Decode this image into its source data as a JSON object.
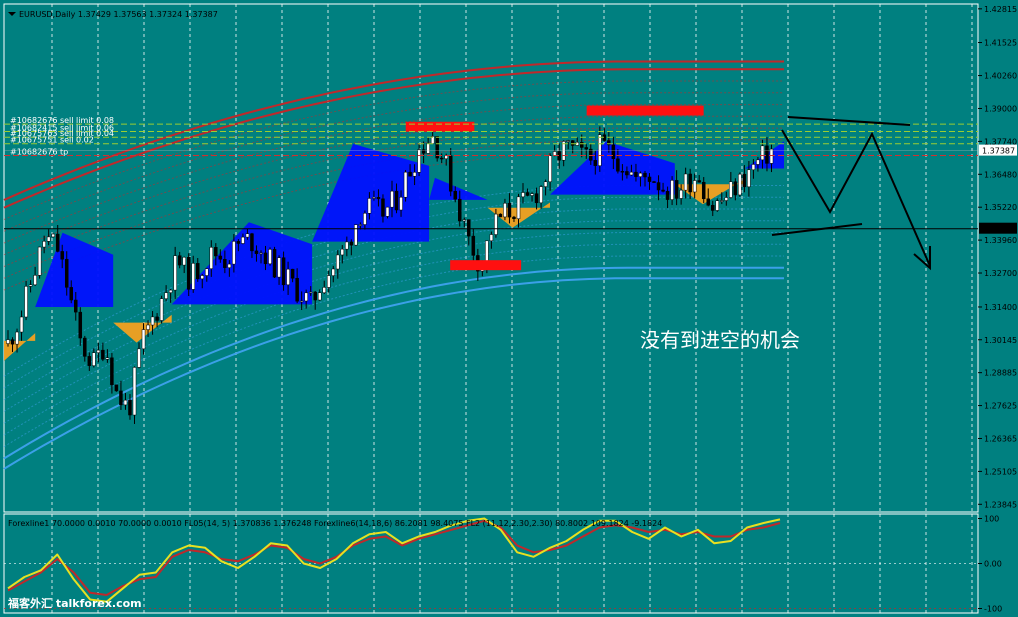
{
  "window": {
    "symbol_header": "EURUSD,Daily  1.37429 1.37563 1.37324 1.37387",
    "indicator_header": "Forexline1 70.0000 0.0010 70.0000 0.0010  FL05(14, 5) 1.370836 1.376248  Forexline6(14,18,6) 86.2081 98.4075  FL2 (11,12,2.30,2.30) 80.8002 109.1824 -9.1824",
    "annotation": "没有到进空的机会",
    "watermark": "福客外汇 talkforex.com"
  },
  "orders": [
    {
      "label": "#10682676 sell limit 0.08",
      "price": 1.384
    },
    {
      "label": "#10682415 sell limit 0.06",
      "price": 1.3812
    },
    {
      "label": "#10675763 sell limit 0.04",
      "price": 1.379
    },
    {
      "label": "#10675751 sell 0.02",
      "price": 1.3765
    },
    {
      "label": "#10682676 tp",
      "price": 1.372
    }
  ],
  "chart_data": [
    {
      "type": "candlestick",
      "symbol": "EURUSD",
      "timeframe": "Daily",
      "last": {
        "open": 1.37429,
        "high": 1.37563,
        "low": 1.37324,
        "close": 1.37387
      },
      "ylim": [
        1.2355,
        1.43
      ],
      "yticks": [
        "1.42815",
        "1.41525",
        "1.40260",
        "1.39000",
        "1.37740",
        "1.36480",
        "1.35220",
        "1.33960",
        "1.32700",
        "1.31400",
        "1.30145",
        "1.28885",
        "1.27625",
        "1.26365",
        "1.25105",
        "1.23845"
      ],
      "price_tags": [
        "1.37387",
        "1.34397"
      ],
      "bid_price": 1.37387,
      "hline_price": 1.34397,
      "grid": true,
      "colors": {
        "up_candle": "#ffffff",
        "down_candle": "#000000",
        "upper_band": "#c0282a",
        "lower_band": "#3ba0e8",
        "hump_blue": "#0010ff",
        "hump_orange": "#f2a01f",
        "zone": "#ff1010",
        "order_line": "#9acd32",
        "tp_line": "#d03030"
      },
      "close_path": [
        1.3,
        1.31,
        1.325,
        1.34,
        1.338,
        1.32,
        1.3,
        1.292,
        1.3,
        1.28,
        1.275,
        1.3,
        1.31,
        1.32,
        1.332,
        1.325,
        1.33,
        1.335,
        1.332,
        1.338,
        1.34,
        1.335,
        1.33,
        1.325,
        1.32,
        1.315,
        1.325,
        1.33,
        1.338,
        1.35,
        1.352,
        1.35,
        1.355,
        1.365,
        1.375,
        1.38,
        1.37,
        1.355,
        1.34,
        1.33,
        1.345,
        1.35,
        1.352,
        1.355,
        1.36,
        1.37,
        1.375,
        1.373,
        1.37,
        1.376,
        1.372,
        1.368,
        1.362,
        1.365,
        1.36,
        1.358,
        1.362,
        1.365,
        1.352,
        1.355,
        1.36,
        1.365,
        1.37,
        1.374
      ],
      "upper_bands": [
        {
          "start": 1.355,
          "peak": 1.408,
          "width": 2.0
        },
        {
          "start": 1.352,
          "peak": 1.405,
          "width": 2.0
        }
      ],
      "lower_bands": [
        {
          "start": 1.256,
          "peak": 1.329,
          "width": 2.0
        },
        {
          "start": 1.252,
          "peak": 1.325,
          "width": 2.0
        }
      ],
      "zones": [
        {
          "x0": 0.515,
          "x1": 0.603,
          "price": 1.383
        },
        {
          "x0": 0.747,
          "x1": 0.897,
          "price": 1.3892
        },
        {
          "x0": 0.572,
          "x1": 0.663,
          "price": 1.33
        }
      ],
      "humps": [
        {
          "x0": 0.0,
          "x1": 0.04,
          "peak": 0.0,
          "top": 1.304,
          "bottom": 1.301,
          "color": "orange"
        },
        {
          "x0": 0.04,
          "x1": 0.14,
          "peak": 0.35,
          "top": 1.334,
          "bottom": 1.314,
          "color": "blue"
        },
        {
          "x0": 0.14,
          "x1": 0.215,
          "peak": 0.4,
          "top": 1.311,
          "bottom": 1.308,
          "color": "orange"
        },
        {
          "x0": 0.215,
          "x1": 0.395,
          "peak": 0.55,
          "top": 1.338,
          "bottom": 1.315,
          "color": "blue"
        },
        {
          "x0": 0.395,
          "x1": 0.545,
          "peak": 0.35,
          "top": 1.368,
          "bottom": 1.339,
          "color": "blue"
        },
        {
          "x0": 0.545,
          "x1": 0.62,
          "peak": 0.1,
          "top": 1.355,
          "bottom": 1.355,
          "color": "blue"
        },
        {
          "x0": 0.62,
          "x1": 0.7,
          "peak": 0.4,
          "top": 1.354,
          "bottom": 1.352,
          "color": "orange"
        },
        {
          "x0": 0.7,
          "x1": 0.86,
          "peak": 0.45,
          "top": 1.369,
          "bottom": 1.357,
          "color": "blue"
        },
        {
          "x0": 0.86,
          "x1": 0.95,
          "peak": 0.4,
          "top": 1.363,
          "bottom": 1.361,
          "color": "orange"
        },
        {
          "x0": 0.95,
          "x1": 1.0,
          "peak": 1.0,
          "top": 1.369,
          "bottom": 1.367,
          "color": "blue"
        }
      ]
    },
    {
      "type": "line",
      "name": "oscillator",
      "ylim": [
        -110,
        110
      ],
      "yticks": [
        "100",
        "0.00",
        "-100"
      ],
      "series": [
        {
          "color": "#c0282a",
          "values": [
            -60,
            -40,
            -20,
            10,
            -20,
            -65,
            -70,
            -50,
            -35,
            -30,
            15,
            30,
            25,
            10,
            5,
            20,
            40,
            35,
            10,
            0,
            15,
            40,
            55,
            60,
            40,
            55,
            65,
            75,
            85,
            95,
            80,
            40,
            25,
            30,
            40,
            60,
            80,
            85,
            80,
            70,
            75,
            65,
            70,
            60,
            60,
            75,
            80,
            90
          ]
        },
        {
          "color": "#e8e020",
          "values": [
            -55,
            -30,
            -15,
            20,
            -35,
            -80,
            -85,
            -55,
            -25,
            -20,
            25,
            40,
            35,
            5,
            -10,
            15,
            45,
            40,
            0,
            -10,
            10,
            45,
            65,
            70,
            45,
            60,
            70,
            85,
            95,
            100,
            75,
            25,
            15,
            35,
            50,
            75,
            95,
            95,
            70,
            55,
            80,
            60,
            75,
            45,
            50,
            80,
            90,
            98
          ]
        }
      ]
    }
  ]
}
